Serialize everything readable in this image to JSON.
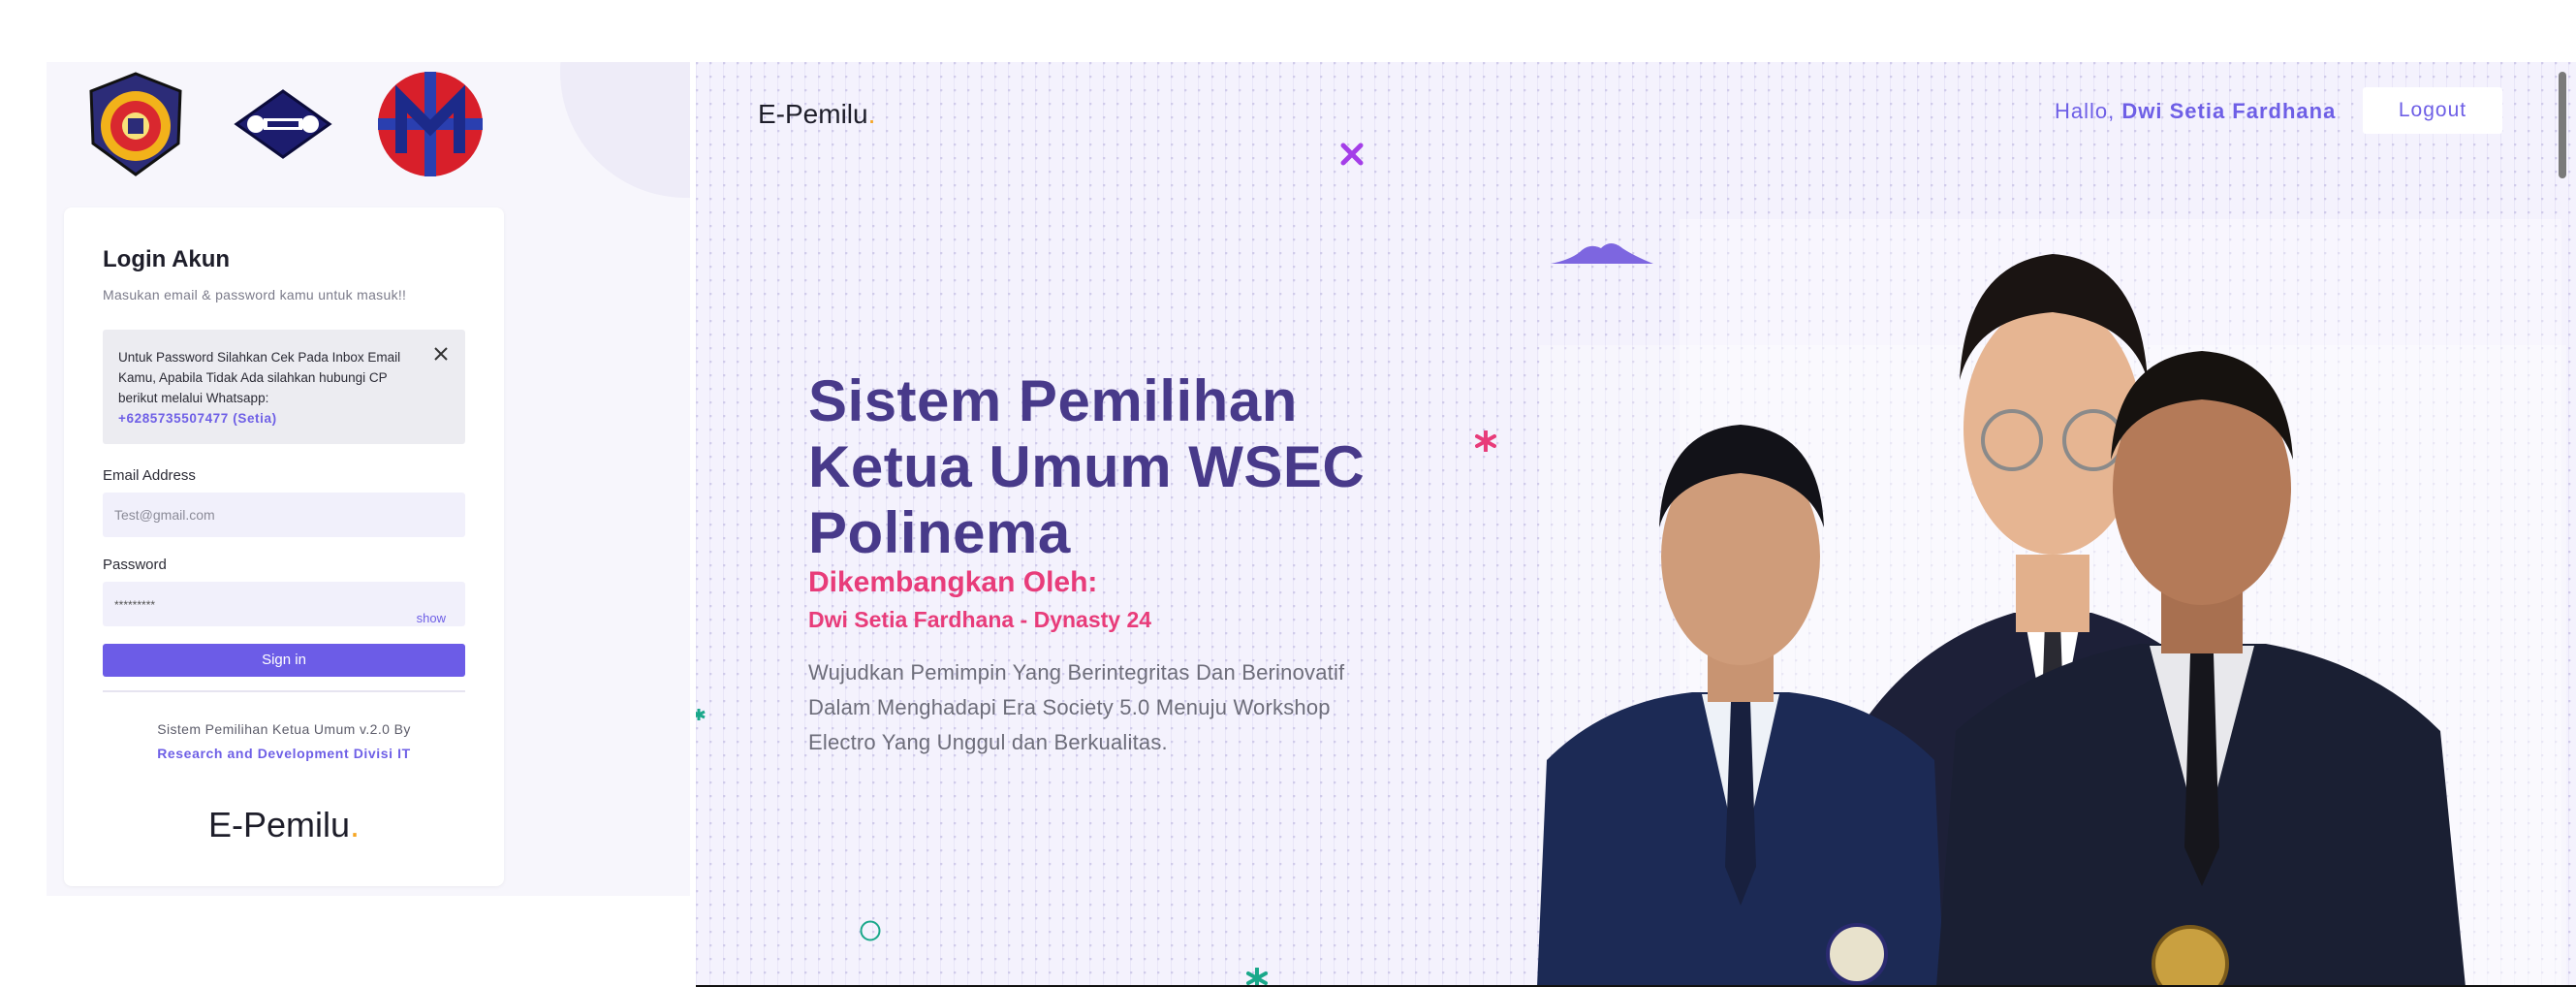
{
  "login": {
    "title": "Login Akun",
    "subtitle": "Masukan email & password kamu untuk masuk!!",
    "notice_text": "Untuk Password Silahkan Cek Pada Inbox Email Kamu, Apabila Tidak Ada silahkan hubungi CP berikut melalui Whatsapp:",
    "notice_phone": "+6285735507477 (Setia)",
    "email_label": "Email Address",
    "email_placeholder": "Test@gmail.com",
    "password_label": "Password",
    "password_value": "*********",
    "show_label": "show",
    "signin_label": "Sign in",
    "credit_line1": "Sistem Pemilihan Ketua Umum v.2.0 By",
    "credit_line2": "Research and Development Divisi IT",
    "brand": "E-Pemilu",
    "brand_dot": "."
  },
  "nav": {
    "brand": "E-Pemilu",
    "brand_dot": ".",
    "greeting": "Hallo,",
    "user_name": "Dwi Setia Fardhana",
    "logout_label": "Logout"
  },
  "hero": {
    "headline": "Sistem Pemilihan Ketua Umum WSEC Polinema",
    "dev_by": "Dikembangkan Oleh:",
    "dev_name": "Dwi Setia Fardhana - Dynasty 24",
    "tagline": "Wujudkan Pemimpin Yang Berintegritas Dan Berinovatif Dalam Menghadapi Era Society 5.0 Menuju Workshop Electro Yang Unggul dan Berkualitas."
  },
  "logos": [
    "polinema-logo",
    "workshop-logo",
    "wsec-logo"
  ],
  "colors": {
    "accent": "#6c5ce7",
    "headline": "#483a8a",
    "pink": "#e83c7a",
    "brand_dot": "#f6a623",
    "hero_bg": "#f4f2fd"
  }
}
